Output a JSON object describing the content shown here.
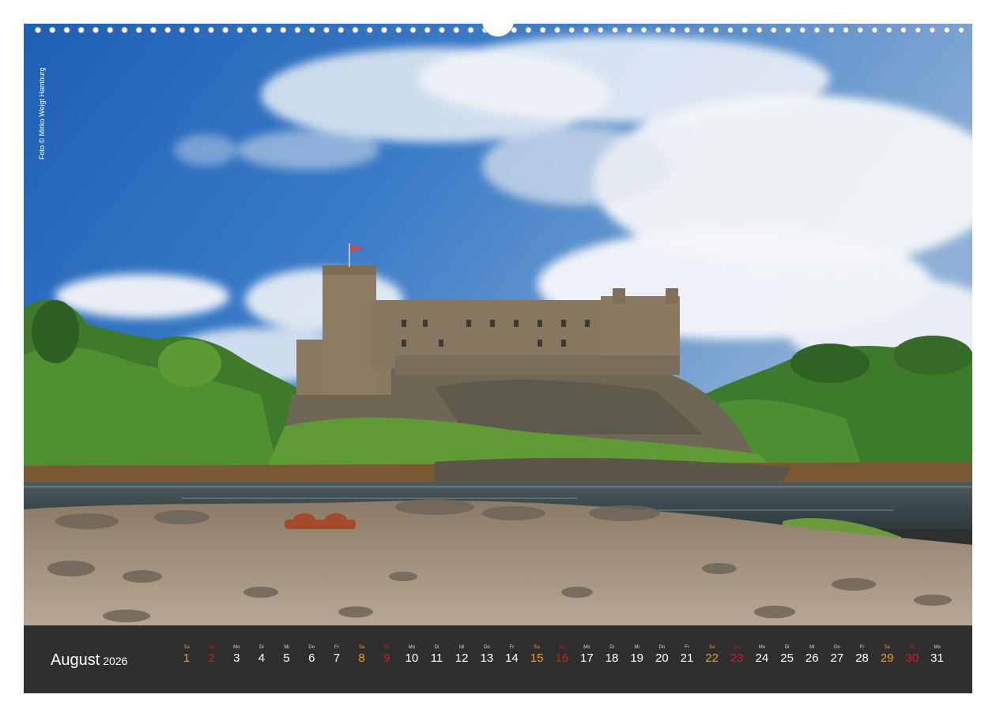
{
  "photo": {
    "credit": "Foto © Mirko Weigt Hamburg",
    "subject": "castle-landscape-photo"
  },
  "calendar": {
    "month": "August",
    "year": "2026",
    "days": [
      {
        "wd": "Sa",
        "d": "1",
        "type": "sat"
      },
      {
        "wd": "So",
        "d": "2",
        "type": "sun"
      },
      {
        "wd": "Mo",
        "d": "3",
        "type": "weekday"
      },
      {
        "wd": "Di",
        "d": "4",
        "type": "weekday"
      },
      {
        "wd": "Mi",
        "d": "5",
        "type": "weekday"
      },
      {
        "wd": "Do",
        "d": "6",
        "type": "weekday"
      },
      {
        "wd": "Fr",
        "d": "7",
        "type": "weekday"
      },
      {
        "wd": "Sa",
        "d": "8",
        "type": "sat"
      },
      {
        "wd": "So",
        "d": "9",
        "type": "sun"
      },
      {
        "wd": "Mo",
        "d": "10",
        "type": "weekday"
      },
      {
        "wd": "Di",
        "d": "11",
        "type": "weekday"
      },
      {
        "wd": "Mi",
        "d": "12",
        "type": "weekday"
      },
      {
        "wd": "Do",
        "d": "13",
        "type": "weekday"
      },
      {
        "wd": "Fr",
        "d": "14",
        "type": "weekday"
      },
      {
        "wd": "Sa",
        "d": "15",
        "type": "sat"
      },
      {
        "wd": "So",
        "d": "16",
        "type": "sun"
      },
      {
        "wd": "Mo",
        "d": "17",
        "type": "weekday"
      },
      {
        "wd": "Di",
        "d": "18",
        "type": "weekday"
      },
      {
        "wd": "Mi",
        "d": "19",
        "type": "weekday"
      },
      {
        "wd": "Do",
        "d": "20",
        "type": "weekday"
      },
      {
        "wd": "Fr",
        "d": "21",
        "type": "weekday"
      },
      {
        "wd": "Sa",
        "d": "22",
        "type": "sat"
      },
      {
        "wd": "So",
        "d": "23",
        "type": "sun"
      },
      {
        "wd": "Mo",
        "d": "24",
        "type": "weekday"
      },
      {
        "wd": "Di",
        "d": "25",
        "type": "weekday"
      },
      {
        "wd": "Mi",
        "d": "26",
        "type": "weekday"
      },
      {
        "wd": "Do",
        "d": "27",
        "type": "weekday"
      },
      {
        "wd": "Fr",
        "d": "28",
        "type": "weekday"
      },
      {
        "wd": "Sa",
        "d": "29",
        "type": "sat"
      },
      {
        "wd": "So",
        "d": "30",
        "type": "sun"
      },
      {
        "wd": "Mo",
        "d": "31",
        "type": "weekday"
      }
    ]
  },
  "colors": {
    "bar_background": "#2f2f2f",
    "saturday": "#e8a21a",
    "sunday": "#d21a1a",
    "weekday": "#ffffff"
  }
}
